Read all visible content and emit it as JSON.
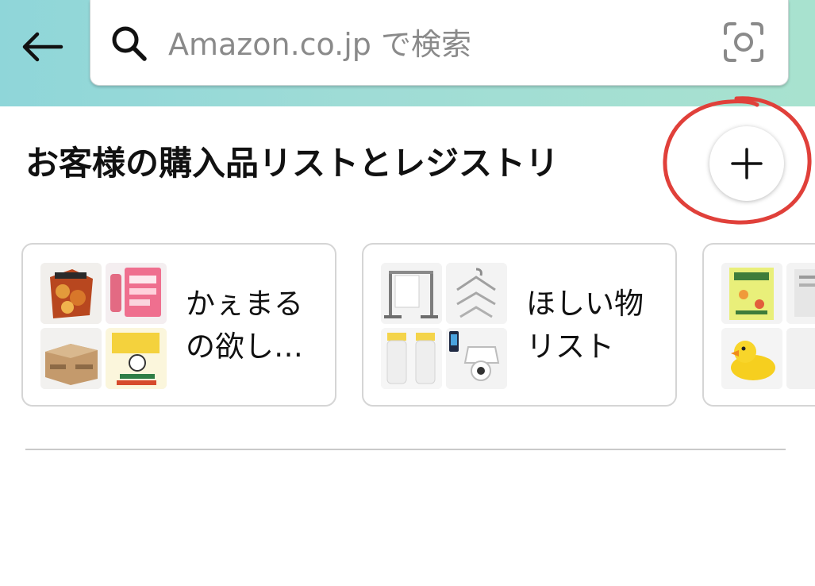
{
  "header": {
    "search_placeholder": "Amazon.co.jp で検索"
  },
  "section": {
    "title": "お客様の購入品リストとレジストリ"
  },
  "lists": [
    {
      "name_line1": "かぇまる",
      "name_line2": "の欲し…"
    },
    {
      "name_line1": "ほしい物",
      "name_line2": "リスト"
    },
    {
      "name_line1": "",
      "name_line2": ""
    }
  ],
  "colors": {
    "header_gradient_start": "#8fd6d9",
    "header_gradient_end": "#a8e2cf",
    "annotation_red": "#e0403a"
  },
  "icons": {
    "back": "arrow-left-icon",
    "search": "search-icon",
    "camera": "camera-scan-icon",
    "add": "plus-icon"
  }
}
